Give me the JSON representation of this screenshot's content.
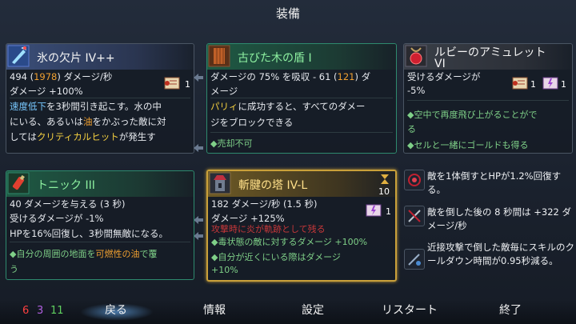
{
  "screen_title": "装備",
  "colors": {
    "common": "#4a5563",
    "uncommon": "#2e8a6e",
    "legendary": "#c9a03a"
  },
  "items": {
    "ice_shard": {
      "name": "氷の欠片 IV++",
      "stat1_a": "494 (",
      "stat1_b": "1978",
      "stat1_c": ") ダメージ/秒",
      "stat2": "ダメージ +100%",
      "desc1_a": "速度低下",
      "desc1_b": "を3秒間引き起こす。水の中",
      "desc2": "にいる、あるいは",
      "desc2_oil": "油",
      "desc2_b": "をかぶった敵に対",
      "desc3_a": "しては",
      "desc3_crit": "クリティカルヒット",
      "desc3_b": "が発生す",
      "scroll_count": "1",
      "icon": "ice-shard-icon"
    },
    "old_shield": {
      "name": "古びた木の盾 I",
      "stat1_a": "ダメージの 75% を吸収 - 61 (",
      "stat1_b": "121",
      "stat1_c": ") ダ",
      "stat2": "メージ",
      "desc1_a": "パリィ",
      "desc1_b": "に成功すると、すべてのダメー",
      "desc2": "ジをブロックできる",
      "footer": "◆売却不可",
      "icon": "wooden-shield-icon"
    },
    "ruby_amulet": {
      "name1": "ルビーのアミュレット",
      "name2": "VI",
      "stat1": "受けるダメージが",
      "stat2": "-5%",
      "perk1_a": "◆空中で再度飛び上がることがで",
      "perk1_b": "き",
      "perk1_c": "る",
      "perk2": "◆セルと一緒にゴールドも得る",
      "scroll_red": "1",
      "scroll_purple": "1",
      "icon": "amulet-icon"
    },
    "tonic": {
      "name": "トニック III",
      "stat1": "40 ダメージを与える (3 秒)",
      "stat2": "受けるダメージが -1%",
      "stat3": "HPを16%回復し、3秒間無敵になる。",
      "perk1_a": "◆自分の周囲の地面を",
      "perk1_b": "可燃性の油",
      "perk1_c": "で覆",
      "perk1_d": "う",
      "icon": "tonic-icon"
    },
    "tower": {
      "name": "斬腱の塔 IV-L",
      "ammo": "10",
      "stat1": "182 ダメージ/秒 (1.5 秒)",
      "stat2": "ダメージ +125%",
      "hidden": "攻撃時に炎が軌跡として残る",
      "perk1": "◆毒状態の敵に対するダメージ +100%",
      "perk2": "◆自分が近くにいる際はダメージ",
      "perk3": "+10%",
      "scroll_purple": "1",
      "icon": "tower-icon"
    }
  },
  "mutations": [
    {
      "icon": "kill-heal-icon",
      "text": "敵を1体倒すとHPが1.2%回復する。"
    },
    {
      "icon": "sword-cross-icon",
      "text": "敵を倒した後の 8 秒間は +322 ダメージ/秒"
    },
    {
      "icon": "melee-cooldown-icon",
      "text": "近接攻撃で倒した敵毎にスキルのクールダウン時間が0.95秒減る。"
    }
  ],
  "stats": {
    "brutality": "6",
    "tactics": "3",
    "survival": "11"
  },
  "menu": {
    "back": "戻る",
    "info": "情報",
    "settings": "設定",
    "restart": "リスタート",
    "quit": "終了"
  }
}
